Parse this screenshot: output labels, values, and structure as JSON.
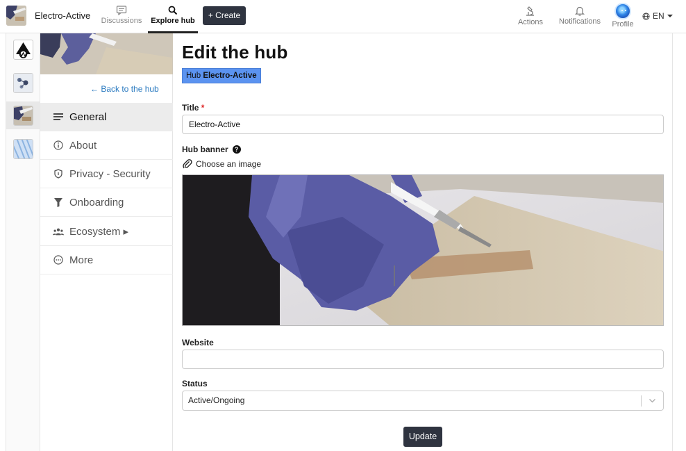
{
  "topnav": {
    "hub_name": "Electro-Active",
    "discussions_label": "Discussions",
    "explore_label": "Explore hub",
    "create_label": "+ Create",
    "actions_label": "Actions",
    "notifications_label": "Notifications",
    "profile_label": "Profile",
    "language": "EN"
  },
  "sidebar": {
    "back_link": "← Back to the hub",
    "items": [
      {
        "label": "General",
        "icon": "lines-icon",
        "active": true
      },
      {
        "label": "About",
        "icon": "info-icon"
      },
      {
        "label": "Privacy - Security",
        "icon": "shield-icon"
      },
      {
        "label": "Onboarding",
        "icon": "funnel-icon"
      },
      {
        "label": "Ecosystem ▸",
        "icon": "people-icon"
      },
      {
        "label": "More",
        "icon": "dots-circle-icon"
      }
    ]
  },
  "main": {
    "title": "Edit the hub",
    "badge_prefix": "Hub",
    "badge_name": "Electro-Active",
    "title_label": "Title",
    "required_mark": "*",
    "title_value": "Electro-Active",
    "banner_label": "Hub banner",
    "help_mark": "?",
    "choose_image": "Choose an image",
    "website_label": "Website",
    "website_value": "",
    "status_label": "Status",
    "status_value": "Active/Ongoing",
    "update_label": "Update"
  },
  "colors": {
    "accent": "#2f3440",
    "badge": "#5b93f0",
    "link": "#2a7ac0"
  }
}
